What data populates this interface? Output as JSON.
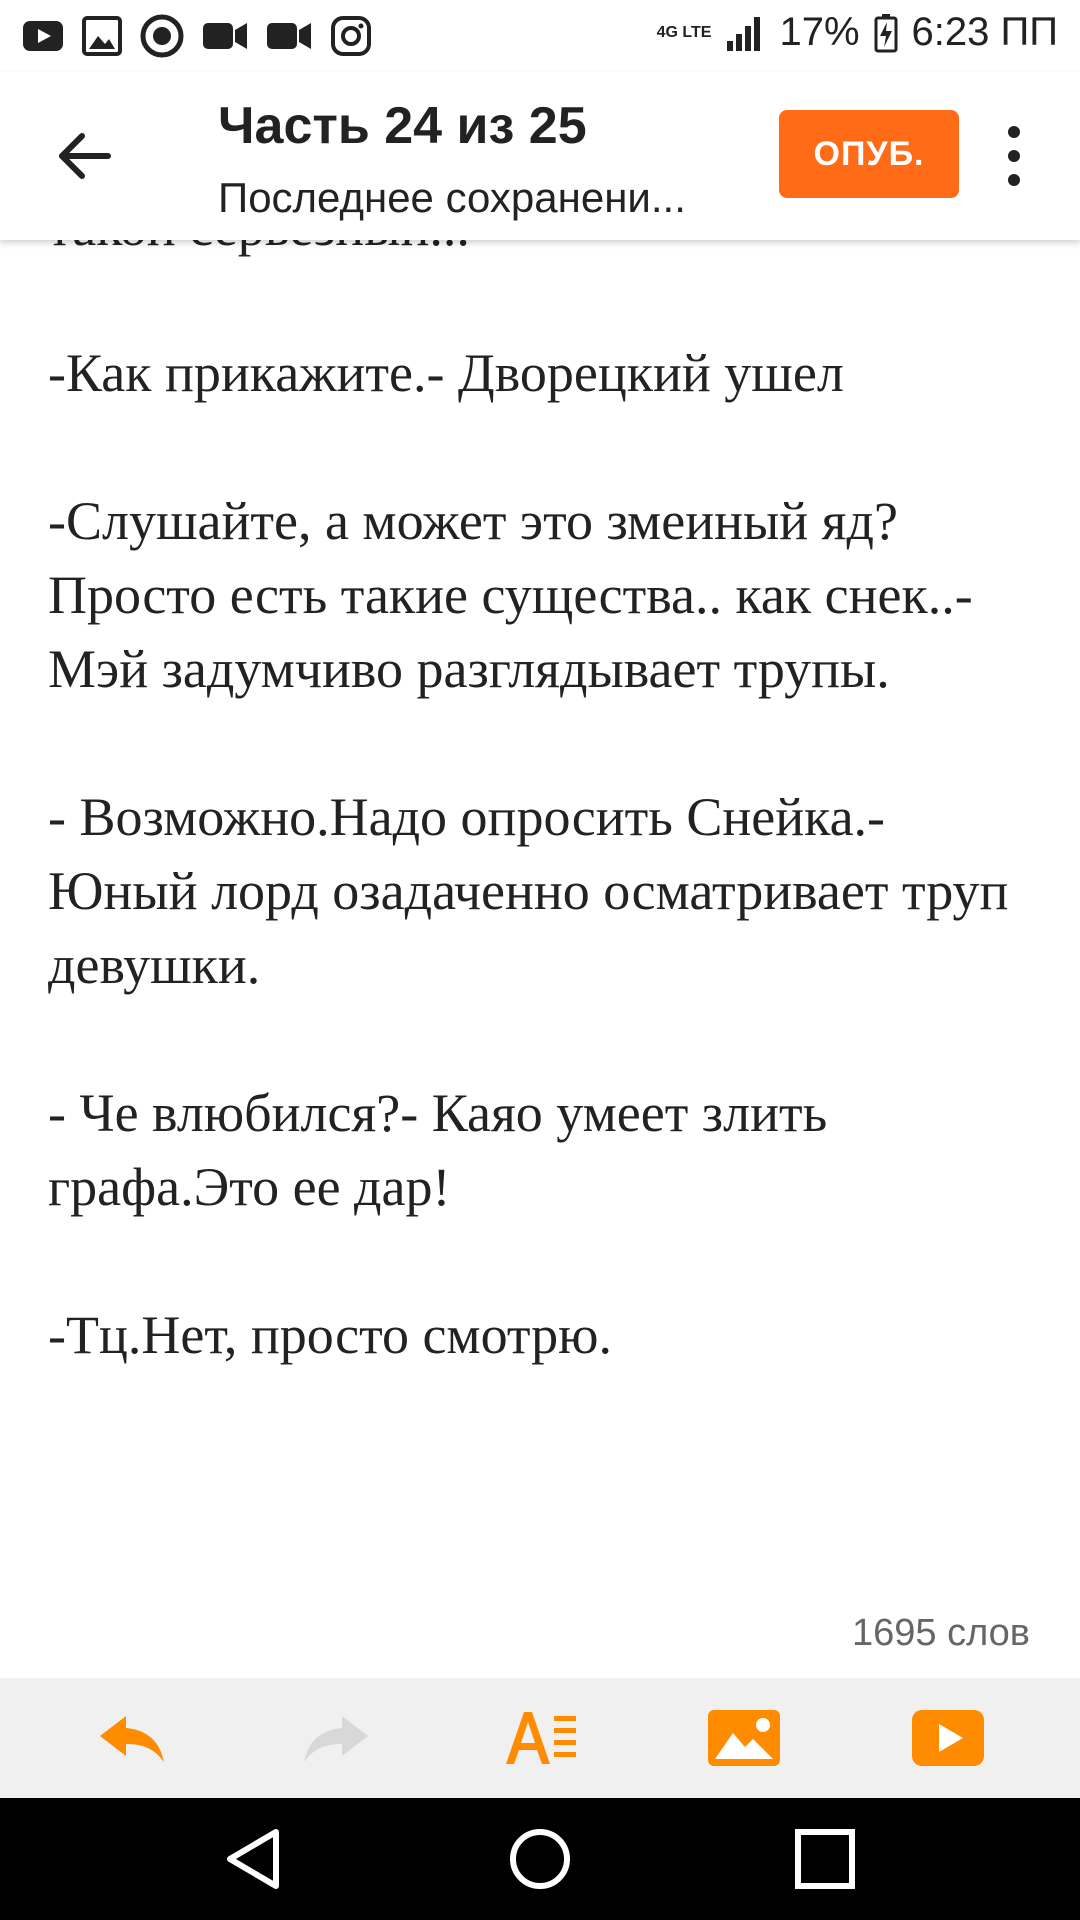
{
  "status_bar": {
    "network": "4G LTE",
    "battery": "17%",
    "time": "6:23 ПП",
    "icons": [
      "youtube-icon",
      "gallery-icon",
      "camera-shutter-icon",
      "video-icon",
      "video-icon",
      "instagram-icon"
    ]
  },
  "header": {
    "title": "Часть 24 из 25",
    "subtitle": "Последнее сохранени...",
    "publish_label": "ОПУБ."
  },
  "content": {
    "paragraphs": [
      "такой серьезный...",
      "-Как прикажите.- Дворецкий ушел",
      "-Слушайте, а может это змеиный яд?Просто есть такие существа.. как снек..-Мэй задумчиво разглядывает трупы.",
      "- Возможно.Надо опросить Снейка.- Юный лорд озадаченно осматривает труп девушки.",
      "- Че влюбился?- Каяо умеет злить графа.Это ее дар!",
      "-Тц.Нет, просто смотрю."
    ],
    "word_count": "1695 слов"
  },
  "toolbar": {
    "accent_color": "#ff8c00",
    "disabled_color": "#d8d8d8",
    "tools": [
      "undo-icon",
      "redo-icon",
      "text-format-icon",
      "insert-image-icon",
      "insert-video-icon"
    ]
  },
  "nav": {
    "buttons": [
      "back-triangle-icon",
      "home-circle-icon",
      "recents-square-icon"
    ]
  }
}
